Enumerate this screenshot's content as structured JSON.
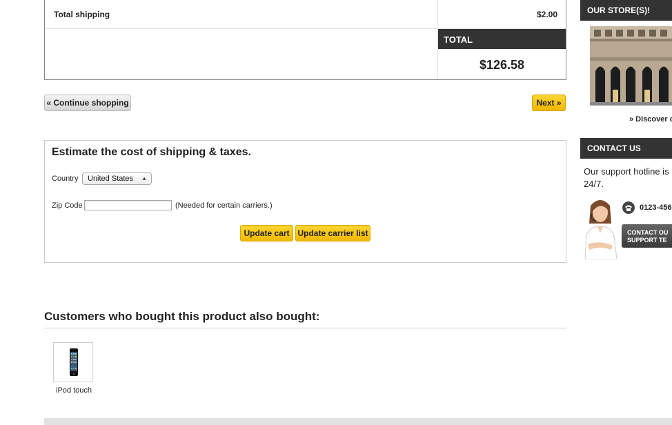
{
  "totals": {
    "shipping_label": "Total shipping",
    "shipping_value": "$2.00",
    "total_label": "TOTAL",
    "total_value": "$126.58"
  },
  "nav": {
    "continue_label": "« Continue shopping",
    "next_label": "Next »"
  },
  "estimate": {
    "title": "Estimate the cost of shipping & taxes.",
    "country_label": "Country",
    "country_value": "United States",
    "zip_label": "Zip Code",
    "zip_value": "",
    "zip_note": "(Needed for certain carriers.)",
    "update_cart_label": "Update cart",
    "update_carrier_label": "Update carrier list"
  },
  "also_bought": {
    "title": "Customers who bought this product also bought:",
    "products": [
      {
        "name": "iPod touch"
      }
    ]
  },
  "sidebar": {
    "stores_title": "OUR STORE(S)!",
    "discover_label": "» Discover o",
    "contact_title": "CONTACT US",
    "hotline_text": "Our support hotline is 24/7.",
    "phone": "0123-456",
    "contact_button_line1": "CONTACT OU",
    "contact_button_line2": "SUPPORT TE"
  },
  "colors": {
    "accent_yellow": "#f5c000",
    "dark_header": "#333333"
  }
}
